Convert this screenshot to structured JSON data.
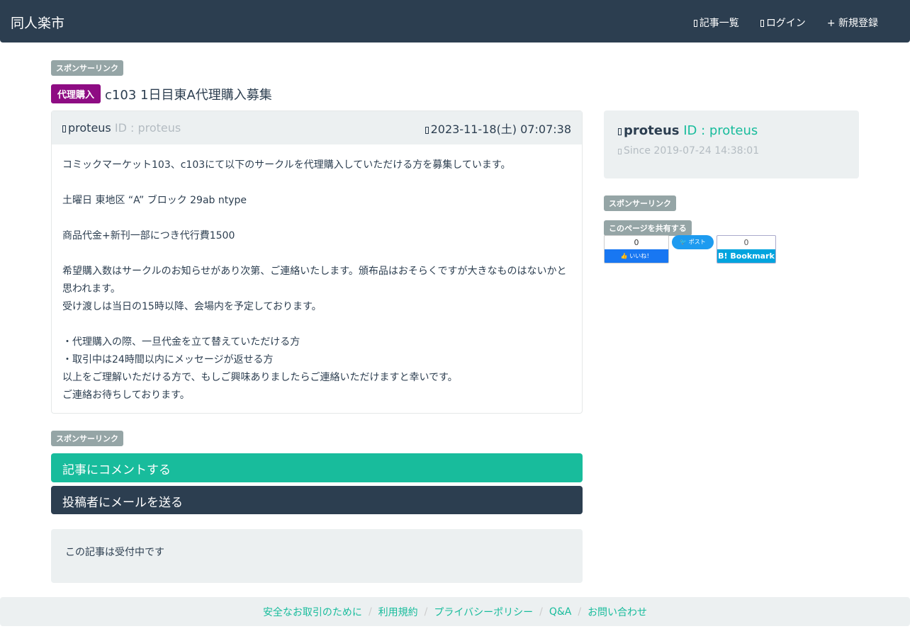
{
  "nav": {
    "brand": "同人楽市",
    "links": [
      "記事一覧",
      "ログイン",
      "+ 新規登録"
    ]
  },
  "sponsor": "スポンサーリンク",
  "post": {
    "category": "代理購入",
    "title": "c103 1日目東A代理購入募集",
    "author": "proteus",
    "author_id": "ID : proteus",
    "date": "2023-11-18(土) 07:07:38",
    "body": "コミックマーケット103、c103にて以下のサークルを代理購入していただける方を募集しています。\n\n土曜日 東地区 “A” ブロック 29ab ntype\n\n商品代金+新刊一部につき代行費1500\n\n希望購入数はサークルのお知らせがあり次第、ご連絡いたします。頒布品はおそらくですが大きなものはないかと思われます。\n受け渡しは当日の15時以降、会場内を予定しております。\n\n・代理購入の際、一旦代金を立て替えていただける方\n・取引中は24時間以内にメッセージが返せる方\n以上をご理解いただける方で、もしご興味ありましたらご連絡いただけますと幸いです。\nご連絡お待ちしております。"
  },
  "profile": {
    "name": "proteus",
    "id": "ID : proteus",
    "since": "Since 2019-07-24 14:38:01"
  },
  "share": {
    "label": "このページを共有する",
    "fb_count": "0",
    "fb_label": "いいね！",
    "tw_label": "ポスト",
    "hb_count": "0",
    "hb_label": "B! Bookmark"
  },
  "actions": {
    "comment": "記事にコメントする",
    "mail": "投稿者にメールを送る"
  },
  "status": "この記事は受付中です",
  "footer": [
    "安全なお取引のために",
    "利用規約",
    "プライバシーポリシー",
    "Q&A",
    "お問い合わせ"
  ]
}
